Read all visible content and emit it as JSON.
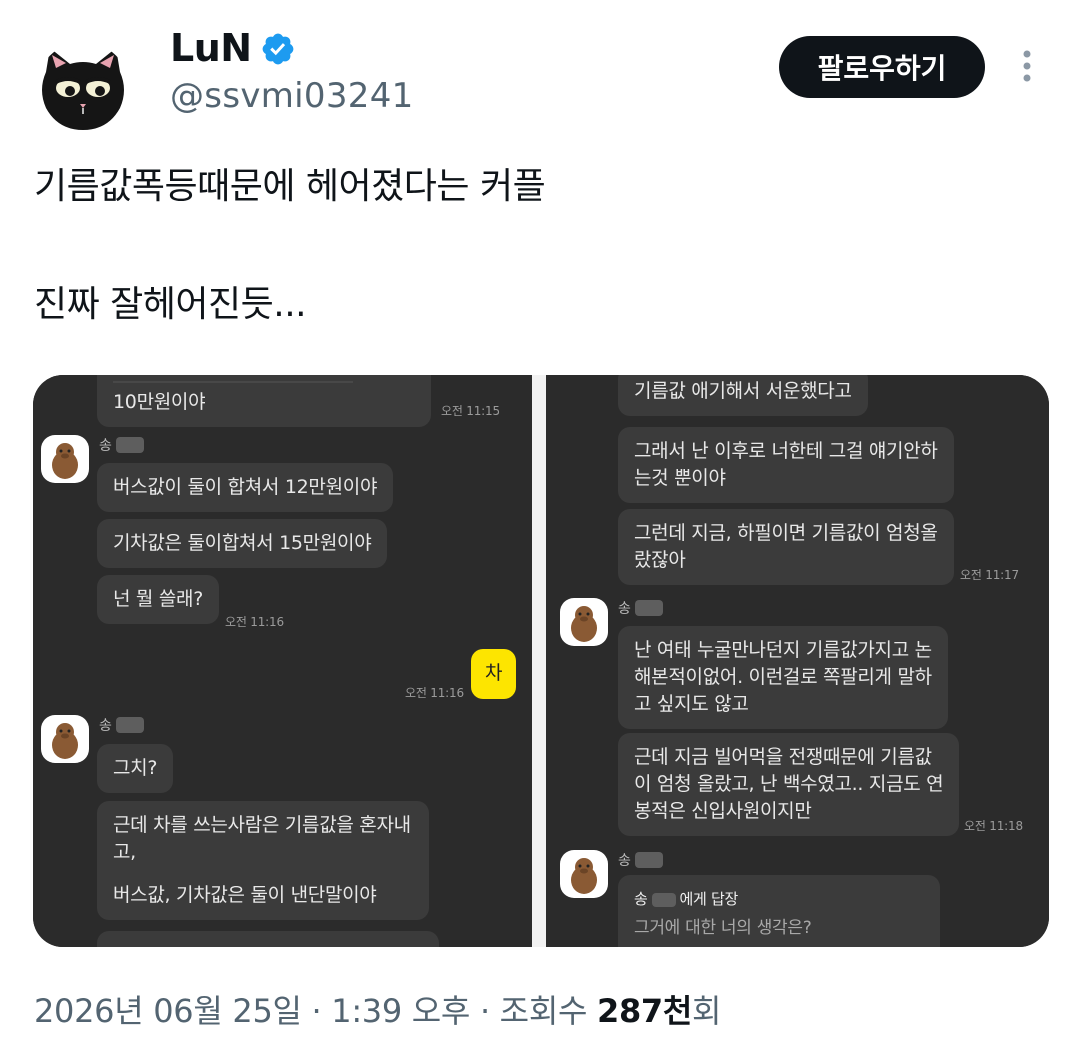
{
  "author": {
    "name": "LuN",
    "handle": "@ssvmi03241",
    "avatar_icon": "black-cat-avatar-icon",
    "verified_icon": "verified-badge-icon",
    "verified_color": "#1d9bf0"
  },
  "follow_button": {
    "label": "팔로우하기"
  },
  "more_icon": "more-vertical-icon",
  "tweet": {
    "line1": "기름값폭등때문에 헤어졌다는 커플",
    "line2": "진짜 잘헤어진듯..."
  },
  "chat_left": {
    "bubble_top": "10만원이야",
    "time_1": "오전 11:15",
    "sender_1": "송",
    "msg_bus": "버스값이 둘이 합쳐서 12만원이야",
    "msg_train": "기차값은 둘이합쳐서 15만원이야",
    "msg_what": "넌 뭘 쓸래?",
    "time_2": "오전 11:16",
    "msg_mine": "차",
    "time_3": "오전 11:16",
    "sender_2": "송",
    "msg_right": "그치?",
    "msg_long_1": "근데 차를 쓰는사람은 기름값을 혼자내",
    "msg_long_2": "고,",
    "msg_long_3": "버스값, 기차값은 둘이 낸단말이야"
  },
  "chat_right": {
    "msg_top": "기름값 애기해서 서운했다고",
    "msg_then_1": "그래서 난 이후로 너한테 그걸 얘기안하",
    "msg_then_2": "는것 뿐이야",
    "msg_now_1": "그런데 지금, 하필이면 기름값이 엄청올",
    "msg_now_2": "랐잖아",
    "time_1": "오전 11:17",
    "sender_1": "송",
    "msg_never_1": "난 여태 누굴만나던지 기름값가지고 논",
    "msg_never_2": "해본적이없어. 이런걸로 쪽팔리게 말하",
    "msg_never_3": "고 싶지도 않고",
    "msg_war_1": "근데 지금 빌어먹을 전쟁때문에 기름값",
    "msg_war_2": "이 엄청 올랐고, 난 백수였고.. 지금도 연",
    "msg_war_3": "봉적은 신입사원이지만",
    "time_2": "오전 11:18",
    "sender_2": "송",
    "reply_prefix": "송",
    "reply_suffix": "에게 답장",
    "reply_body": "그거에 대한 너의 생각은?"
  },
  "footer": {
    "datetime": "2026년 06월 25일 · 1:39 오후 · 조회수 ",
    "views": "287천",
    "views_suffix": "회"
  }
}
